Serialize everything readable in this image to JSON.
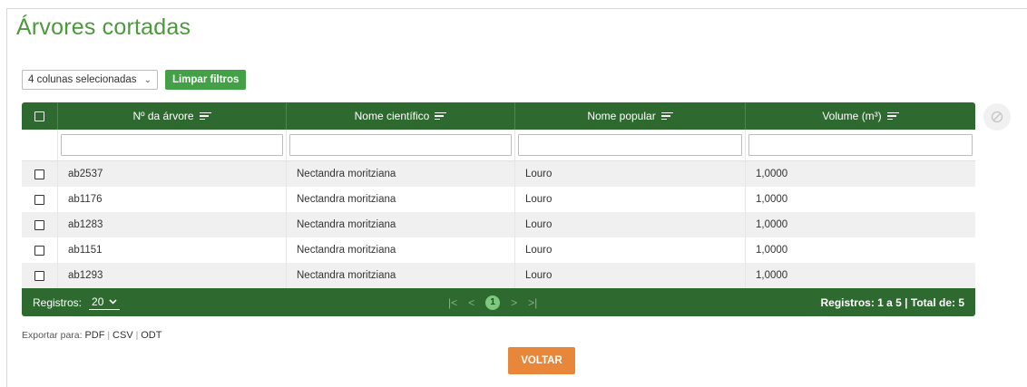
{
  "page": {
    "title": "Árvores cortadas"
  },
  "toolbar": {
    "columns_select_value": "4 colunas selecionadas",
    "clear_filters_label": "Limpar filtros"
  },
  "table": {
    "columns": [
      "Nº da árvore",
      "Nome científico",
      "Nome popular",
      "Volume (m³)"
    ],
    "rows": [
      [
        "ab2537",
        "Nectandra moritziana",
        "Louro",
        "1,0000"
      ],
      [
        "ab1176",
        "Nectandra moritziana",
        "Louro",
        "1,0000"
      ],
      [
        "ab1283",
        "Nectandra moritziana",
        "Louro",
        "1,0000"
      ],
      [
        "ab1151",
        "Nectandra moritziana",
        "Louro",
        "1,0000"
      ],
      [
        "ab1293",
        "Nectandra moritziana",
        "Louro",
        "1,0000"
      ]
    ]
  },
  "footer": {
    "per_page_label": "Registros:",
    "per_page_value": "20",
    "current_page": "1",
    "summary": "Registros: 1 a 5 | Total de: 5"
  },
  "export": {
    "label": "Exportar para:",
    "pdf": "PDF",
    "csv": "CSV",
    "odt": "ODT"
  },
  "actions": {
    "back_label": "VOLTAR"
  },
  "colors": {
    "title_green": "#4c9a3c",
    "header_green": "#2e6a30",
    "button_green": "#43a047",
    "back_orange": "#e8873a"
  },
  "icons": {
    "sort": "sort-lines-icon",
    "clear": "slashed-circle-icon",
    "first": "first-page-icon",
    "prev": "prev-page-icon",
    "next": "next-page-icon",
    "last": "last-page-icon"
  }
}
